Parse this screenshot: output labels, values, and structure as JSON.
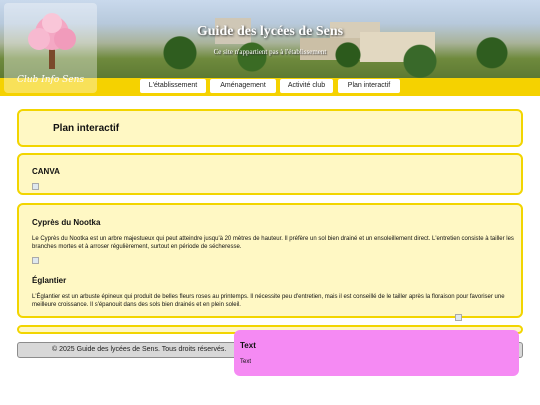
{
  "header": {
    "logo_text": "Club Info Sens",
    "title": "Guide des lycées de Sens",
    "subtitle": "Ce site n'appartient pas à l'établissement"
  },
  "nav": {
    "items": [
      {
        "label": "L'établissement"
      },
      {
        "label": "Aménagement"
      },
      {
        "label": "Activité club"
      },
      {
        "label": "Plan interactif"
      }
    ]
  },
  "main": {
    "page_title": "Plan interactif",
    "canva": {
      "title": "CANVA"
    },
    "entries": [
      {
        "title": "Cyprès du Nootka",
        "text": "Le Cyprès du Nootka est un arbre majestueux qui peut atteindre jusqu'à 20 mètres de hauteur. Il préfère un sol bien drainé et un ensoleillement direct. L'entretien consiste à tailler les branches mortes et à arroser régulièrement, surtout en période de sécheresse."
      },
      {
        "title": "Églantier",
        "text": "L'Églantier est un arbuste épineux qui produit de belles fleurs roses au printemps. Il nécessite peu d'entretien, mais il est conseillé de le tailler après la floraison pour favoriser une meilleure croissance. Il s'épanouit dans des sols bien drainés et en plein soleil."
      }
    ]
  },
  "footer": {
    "text": "© 2025 Guide des lycées de Sens. Tous droits réservés."
  },
  "popup": {
    "title": "Text",
    "body": "Text"
  },
  "colors": {
    "accent_yellow": "#f5d200",
    "box_bg": "#fff8c4",
    "popup_pink": "#f58af3"
  },
  "icons": {
    "image_placeholder": "broken-image-icon"
  }
}
